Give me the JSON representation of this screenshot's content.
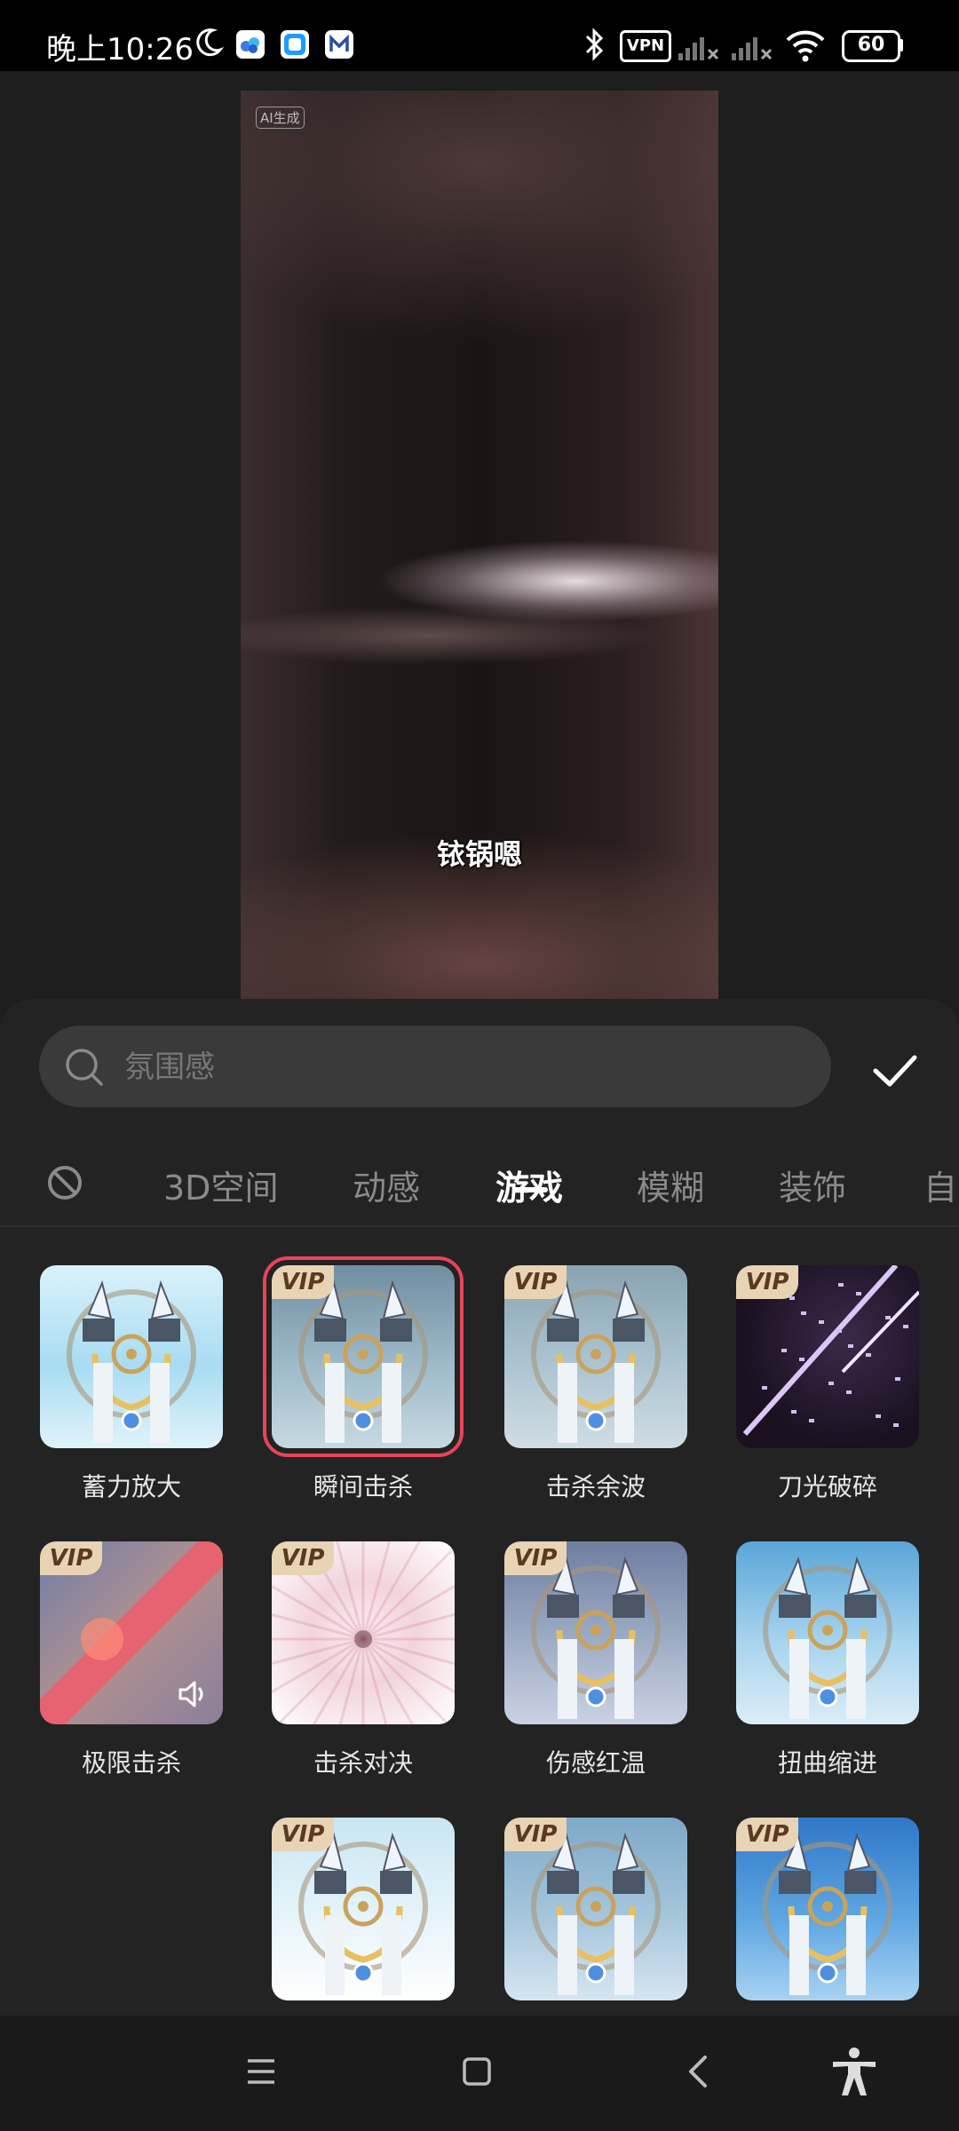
{
  "status_bar": {
    "time": "晚上10:26",
    "vpn_label": "VPN",
    "battery": "60"
  },
  "preview": {
    "ai_badge": "AI生成",
    "subtitle": "铱锅嗯"
  },
  "search": {
    "placeholder": "氛围感",
    "value": ""
  },
  "tabs": [
    {
      "label": "3D空间"
    },
    {
      "label": "动感"
    },
    {
      "label": "游戏"
    },
    {
      "label": "模糊"
    },
    {
      "label": "装饰"
    },
    {
      "label": "自"
    }
  ],
  "active_tab": "游戏",
  "effects": [
    {
      "label": "蓄力放大",
      "vip": false
    },
    {
      "label": "瞬间击杀",
      "vip": true,
      "selected": true
    },
    {
      "label": "击杀余波",
      "vip": true
    },
    {
      "label": "刀光破碎",
      "vip": true
    },
    {
      "label": "极限击杀",
      "vip": true,
      "has_sound": true
    },
    {
      "label": "击杀对决",
      "vip": true
    },
    {
      "label": "伤感红温",
      "vip": true
    },
    {
      "label": "扭曲缩进",
      "vip": false
    },
    {
      "label": "",
      "vip": true
    },
    {
      "label": "",
      "vip": true
    },
    {
      "label": "",
      "vip": true
    }
  ],
  "vip_text": "VIP",
  "colors": {
    "accent_selected": "#e8445a",
    "panel_bg": "#232323",
    "vip_badge": "#e9d3b5"
  },
  "icons": {
    "nav": [
      "menu-icon",
      "home-icon",
      "back-icon",
      "accessibility-icon"
    ]
  }
}
